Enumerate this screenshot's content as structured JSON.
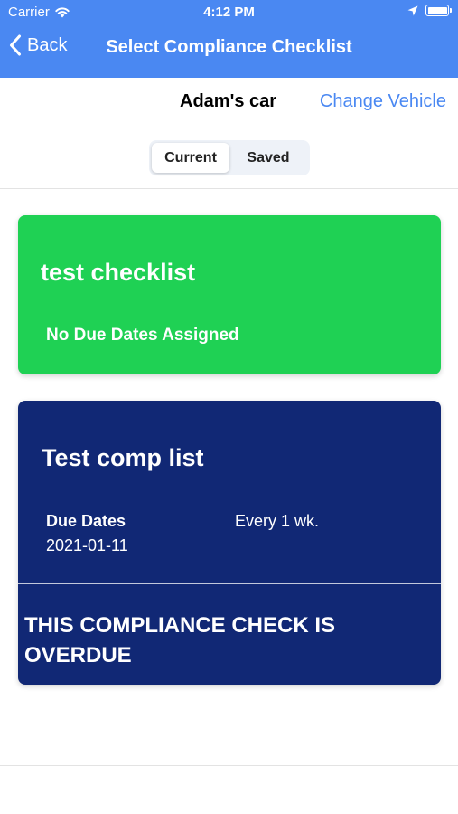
{
  "status_bar": {
    "carrier": "Carrier",
    "time": "4:12 PM"
  },
  "nav": {
    "back_label": "Back",
    "title": "Select Compliance Checklist"
  },
  "vehicle": {
    "name": "Adam's car",
    "change_label": "Change Vehicle"
  },
  "tabs": [
    {
      "label": "Current",
      "selected": true
    },
    {
      "label": "Saved",
      "selected": false
    }
  ],
  "checklists": [
    {
      "title": "test checklist",
      "subtitle": "No Due Dates Assigned",
      "color": "#1FD154"
    },
    {
      "title": "Test comp list",
      "due_label": "Due Dates",
      "due_date": "2021-01-11",
      "frequency": "Every 1 wk.",
      "warning": "THIS COMPLIANCE CHECK IS OVERDUE",
      "color": "#112875"
    }
  ],
  "colors": {
    "header": "#4A88F2",
    "accent": "#4A88F2"
  },
  "icons": {
    "wifi": "wifi-icon",
    "location": "location-arrow-icon",
    "battery": "battery-icon",
    "back": "chevron-left-icon"
  }
}
